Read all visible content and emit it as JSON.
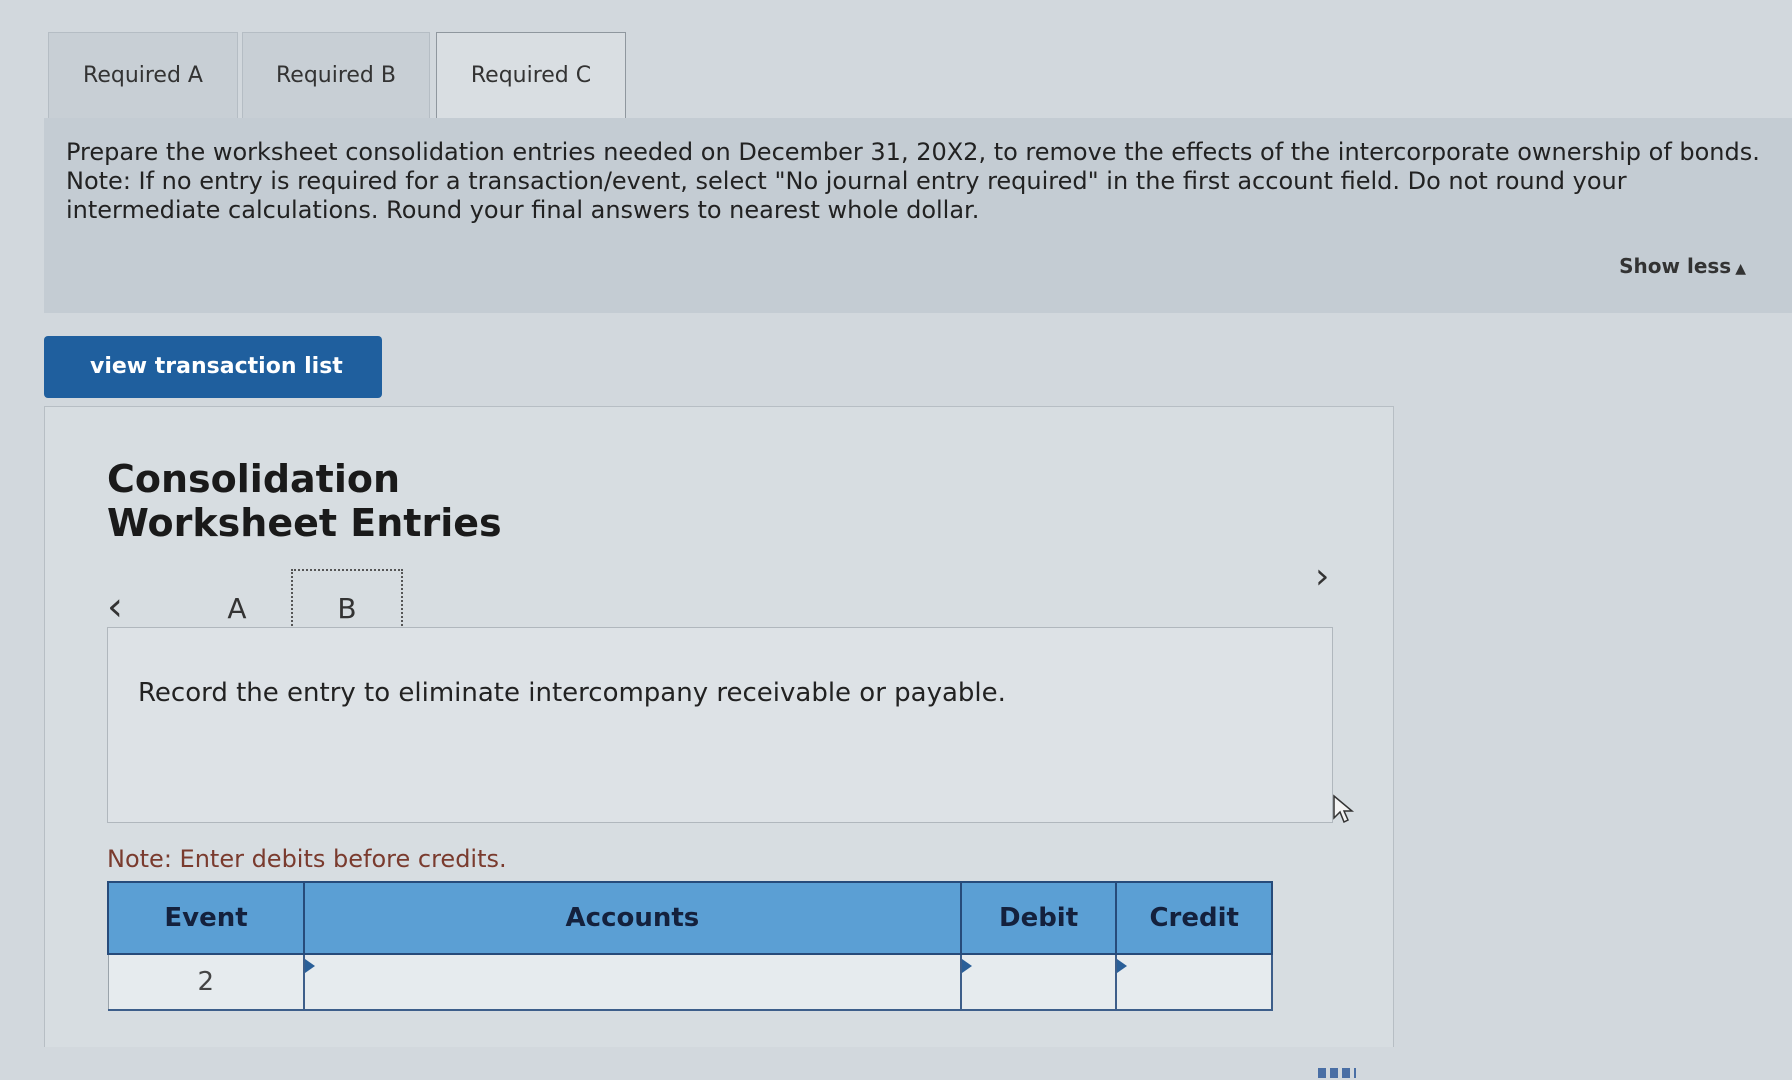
{
  "tabs": [
    {
      "label": "Required A"
    },
    {
      "label": "Required B"
    },
    {
      "label": "Required C"
    }
  ],
  "instructions": {
    "line1": "Prepare the worksheet consolidation entries needed on December 31, 20X2, to remove the effects of the intercorporate ownership of bonds.",
    "line2": "Note: If no entry is required for a transaction/event, select \"No journal entry required\" in the first account field. Do not round your intermediate calculations. Round your final answers to nearest whole dollar.",
    "show_less": "Show less"
  },
  "view_button": {
    "label": "view transaction list"
  },
  "worksheet": {
    "title": "Consolidation Worksheet Entries",
    "entry_tabs": [
      "A",
      "B"
    ],
    "description": "Record the entry to eliminate intercompany receivable or payable.",
    "note": "Note: Enter debits before credits.",
    "table": {
      "headers": {
        "event": "Event",
        "accounts": "Accounts",
        "debit": "Debit",
        "credit": "Credit"
      },
      "rows": [
        {
          "event": "2",
          "account": "",
          "debit": "",
          "credit": ""
        }
      ]
    }
  },
  "icons": {
    "prev": "chevron-left-icon",
    "next": "chevron-right-icon",
    "show_less": "triangle-up-icon",
    "cursor": "mouse-pointer-icon"
  },
  "colors": {
    "button_bg": "#1f5f9e",
    "table_header_bg": "#5b9fd4",
    "page_bg": "#d2d8dd"
  }
}
